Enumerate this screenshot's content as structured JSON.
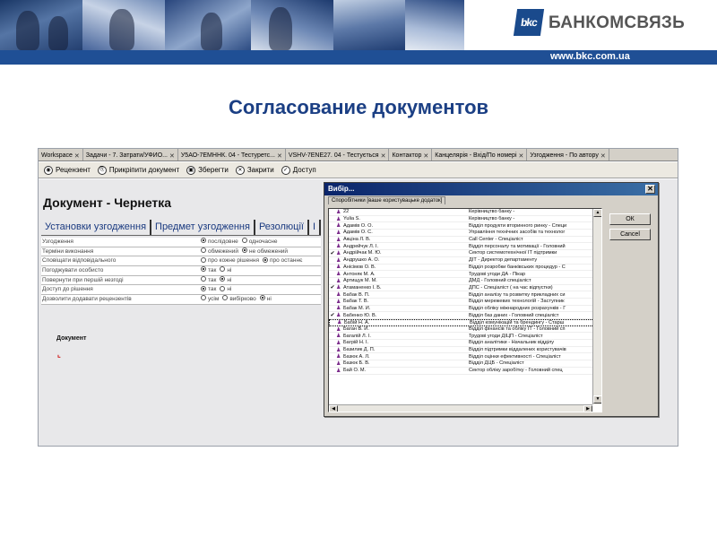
{
  "header": {
    "logo_mark": "bkc",
    "logo_text": "БАНКОМСВЯЗЬ",
    "url": "www.bkc.com.ua",
    "brand_color": "#1f4f95"
  },
  "slide": {
    "title": "Согласование документов"
  },
  "app": {
    "tabs": [
      {
        "label": "Workspace"
      },
      {
        "label": "Задачи - 7. Затрати/УФИО..."
      },
      {
        "label": "У5АО-7ЕМННК. 04 - Тестуретс..."
      },
      {
        "label": "VSHV-7ENE27. 04 - Тестується"
      },
      {
        "label": "Контактор"
      },
      {
        "label": "Канцелярія - Вхід/По номері"
      },
      {
        "label": "Узгодження - По автору"
      }
    ],
    "toolbar": [
      {
        "label": "Рецензент",
        "icon": "review-icon"
      },
      {
        "label": "Прикріпити документ",
        "icon": "attach-icon"
      },
      {
        "label": "Зберегти",
        "icon": "save-icon"
      },
      {
        "label": "Закрити",
        "icon": "close-icon"
      },
      {
        "label": "Доступ",
        "icon": "access-icon"
      }
    ],
    "doc_title": "Документ - Чернетка",
    "doc_tabs": [
      "Установки узгодження",
      "Предмет узгодження",
      "Резолюції",
      "І"
    ],
    "form_rows": [
      {
        "label": "Узгодження",
        "opts": [
          {
            "t": "послідовне",
            "on": true
          },
          {
            "t": "одночасне",
            "on": false
          }
        ]
      },
      {
        "label": "Терміни виконання",
        "opts": [
          {
            "t": "обмежений",
            "on": false
          },
          {
            "t": "не обмежений",
            "on": true
          }
        ]
      },
      {
        "label": "Сповіщати відповідального",
        "opts": [
          {
            "t": "про кожне рішення",
            "on": false
          },
          {
            "t": "про останнє",
            "on": true
          }
        ]
      },
      {
        "label": "Погоджувати особисто",
        "opts": [
          {
            "t": "так",
            "on": true
          },
          {
            "t": "ні",
            "on": false
          }
        ]
      },
      {
        "label": "Повернути при першій незгоді",
        "opts": [
          {
            "t": "так",
            "on": false
          },
          {
            "t": "ні",
            "on": true
          }
        ]
      },
      {
        "label": "Доступ до рішення",
        "opts": [
          {
            "t": "так",
            "on": true
          },
          {
            "t": "ні",
            "on": false
          }
        ]
      },
      {
        "label": "Дозволити додавати рецензентів",
        "opts": [
          {
            "t": "усім",
            "on": false
          },
          {
            "t": "вибірково",
            "on": false
          },
          {
            "t": "ні",
            "on": true
          }
        ]
      }
    ],
    "doc_section_label": "Документ"
  },
  "dialog": {
    "title": "Вибір...",
    "tab_label": "Споробітники [ваше користувацьке додаток]",
    "ok_label": "ОК",
    "cancel_label": "Cancel",
    "rows": [
      {
        "name": "22",
        "desc": "Керівництво банку -",
        "checked": false
      },
      {
        "name": "Yulia S.",
        "desc": "Керівництво банку -",
        "checked": false
      },
      {
        "name": "Адамів О. О.",
        "desc": "Відділ продукти вторинного ринку - Специ",
        "checked": false
      },
      {
        "name": "Адамів О. С.",
        "desc": "Управління технічних засобів та технолог",
        "checked": false
      },
      {
        "name": "Акціна Л. В.",
        "desc": "Call Center - Спеціаліст",
        "checked": false
      },
      {
        "name": "Андрейчук Л. І.",
        "desc": "Відділ персоналу та мотивації - Головний",
        "checked": false
      },
      {
        "name": "Андрійчак М. Ю.",
        "desc": "Сектор системотехнічної ІТ підтримки",
        "checked": true
      },
      {
        "name": "Андрушко А. О.",
        "desc": "ДІТ - Директор департаменту",
        "checked": false
      },
      {
        "name": "Анісімов О. В.",
        "desc": "Відділ розробки банківських процедур - С",
        "checked": false
      },
      {
        "name": "Антоняк М. А.",
        "desc": "Трудові угоди ДА - Пікар",
        "checked": false
      },
      {
        "name": "Артищук М. М.",
        "desc": "ДМД - Головний спеціаліст",
        "checked": false
      },
      {
        "name": "Атаманенко І. Б.",
        "desc": "ДПС - Спеціаліст ( на час відпустки)",
        "checked": true
      },
      {
        "name": "Бабак В. П.",
        "desc": "Відділ аналізу та розвитку прикладних си",
        "checked": false
      },
      {
        "name": "Бабак Т. В.",
        "desc": "Відділ мережевих технологій - Заступник",
        "checked": false
      },
      {
        "name": "Бабак М. Й.",
        "desc": "Відділ обліку міжнародних розрахунків - Г",
        "checked": false
      },
      {
        "name": "Бабенко Ю. В.",
        "desc": "Відділ баз даних - Головний спеціаліст",
        "checked": true
      },
      {
        "name": "Бабій Н. А.",
        "desc": "Відділ комунікацій та брендингу - Старш",
        "checked": false,
        "sel": true
      },
      {
        "name": "Баган В. Й.",
        "desc": "Відділ фінансів та обліку ІТ - Головний сп",
        "checked": false
      },
      {
        "name": "Багалій Л. І.",
        "desc": "Трудові угоди ДІЦП - Спеціаліст",
        "checked": false
      },
      {
        "name": "Багрій Н. І.",
        "desc": "Відділ аналітики - Начальник відділу",
        "checked": false
      },
      {
        "name": "Базилик Д. П.",
        "desc": "Відділ підтримки віддалених користувачів",
        "checked": false
      },
      {
        "name": "Базюк А. Л.",
        "desc": "Відділ оцінки ефективності - Спеціаліст",
        "checked": false
      },
      {
        "name": "Базюк Б. В.",
        "desc": "Відділ ДЦБ - Спеціаліст",
        "checked": false
      },
      {
        "name": "Бай О. М.",
        "desc": "Сектор обліку заробітку - Головний спец",
        "checked": false
      }
    ]
  }
}
